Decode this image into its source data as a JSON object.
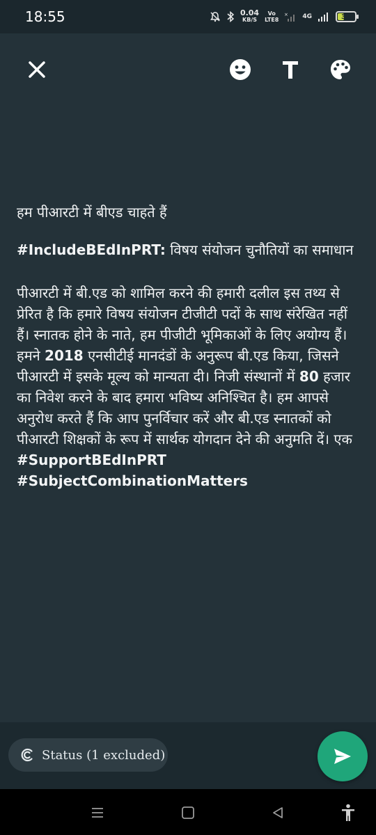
{
  "status_bar": {
    "time": "18:55",
    "net_speed_value": "0.04",
    "net_speed_unit": "KB/S",
    "volte_top": "Vo",
    "volte_bottom": "LTE8",
    "network": "4G",
    "battery": "33",
    "icons": [
      "mute-icon",
      "bluetooth-icon",
      "signal-icon",
      "battery-icon"
    ]
  },
  "toolbar": {
    "icons": [
      "close-icon",
      "emoji-icon",
      "text-style-icon",
      "color-palette-icon"
    ]
  },
  "status_text": {
    "title": "हम पीआरटी में बीएड चाहते हैं",
    "hashtag_heading": "#IncludeBEdInPRT:",
    "subtitle": " विषय संयोजन चुनौतियों का समाधान",
    "body_part1": "पीआरटी में बी.एड को शामिल करने की हमारी दलील इस तथ्य से प्रेरित है कि हमारे विषय संयोजन टीजीटी पदों के साथ संरेखित नहीं हैं। स्नातक होने के नाते, हम पीजीटी भूमिकाओं के लिए अयोग्य हैं। हमने ",
    "year": "2018",
    "body_part2": " एनसीटीई मानदंडों के अनुरूप बी.एड किया, जिसने पीआरटी में इसके मूल्य को मान्यता दी। निजी संस्थानों में ",
    "amount": "80",
    "body_part3": " हजार का निवेश करने के बाद हमारा भविष्य अनिश्चित है। हम आपसे अनुरोध करते हैं कि आप पुनर्विचार करें और बी.एड स्नातकों को पीआरटी शिक्षकों के रूप में सार्थक योगदान देने की अनुमति दें। एक",
    "tag1": "#SupportBEdInPRT",
    "tag2": "#SubjectCombinationMatters"
  },
  "bottom": {
    "audience_label": "Status (1 excluded)",
    "send_icon": "send-icon"
  },
  "colors": {
    "background": "#243239",
    "fab": "#1fa67a",
    "chip": "#2f3d44"
  }
}
